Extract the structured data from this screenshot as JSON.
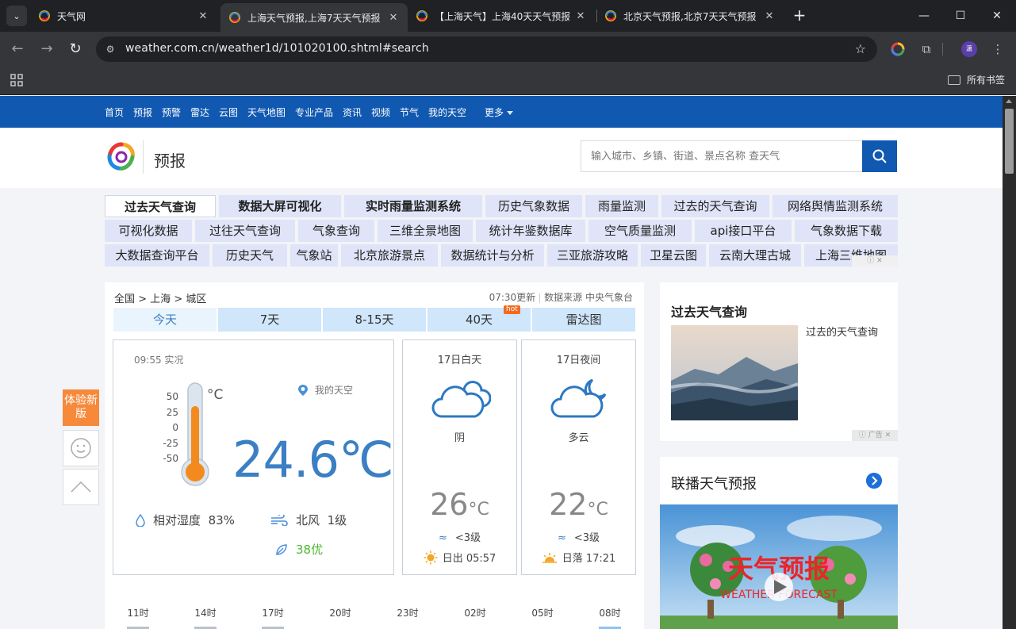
{
  "browser": {
    "tabs": [
      {
        "title": "天气网",
        "active": false
      },
      {
        "title": "上海天气预报,上海7天天气预报",
        "active": true
      },
      {
        "title": "【上海天气】上海40天天气预报",
        "active": false
      },
      {
        "title": "北京天气预报,北京7天天气预报",
        "active": false
      }
    ],
    "url": "weather.com.cn/weather1d/101020100.shtml#search",
    "bookmarks_label": "所有书签",
    "profile_initial": "潇"
  },
  "topnav": [
    "首页",
    "预报",
    "预警",
    "雷达",
    "云图",
    "天气地图",
    "专业产品",
    "资讯",
    "视频",
    "节气",
    "我的天空"
  ],
  "topnav_more": "更多",
  "header": {
    "title": "预报",
    "search_placeholder": "输入城市、乡镇、街道、景点名称 查天气"
  },
  "links": {
    "row1": [
      "过去天气查询",
      "数据大屏可视化",
      "实时雨量监测系统",
      "历史气象数据",
      "雨量监测",
      "过去的天气查询",
      "网络舆情监测系统"
    ],
    "row2": [
      "可视化数据",
      "过往天气查询",
      "气象查询",
      "三维全景地图",
      "统计年鉴数据库",
      "空气质量监测",
      "api接口平台",
      "气象数据下载"
    ],
    "row3": [
      "大数据查询平台",
      "历史天气",
      "气象站",
      "北京旅游景点",
      "数据统计与分析",
      "三亚旅游攻略",
      "卫星云图",
      "云南大理古城",
      "上海三维地图"
    ]
  },
  "breadcrumb": "全国 > 上海 > 城区",
  "update_time": "07:30更新",
  "data_source": "数据来源 中央气象台",
  "day_tabs": [
    "今天",
    "7天",
    "8-15天",
    "40天",
    "雷达图"
  ],
  "hot_label": "hot",
  "now": {
    "time_label": "09:55 实况",
    "my_sky": "我的天空",
    "thermo_ticks": [
      "50",
      "25",
      "0",
      "-25",
      "-50"
    ],
    "thermo_unit": "°C",
    "temperature": "24.6",
    "temp_unit": "℃",
    "humidity_label": "相对湿度",
    "humidity_value": "83%",
    "wind_dir": "北风",
    "wind_level": "1级",
    "aqi": "38优"
  },
  "day": {
    "title": "17日白天",
    "weather": "阴",
    "temp": "26",
    "unit": "°C",
    "wind": "<3级",
    "sun_label": "日出 05:57"
  },
  "night": {
    "title": "17日夜间",
    "weather": "多云",
    "temp": "22",
    "unit": "°C",
    "wind": "<3级",
    "sun_label": "日落 17:21"
  },
  "hours": [
    "11时",
    "14时",
    "17时",
    "20时",
    "23时",
    "02时",
    "05时",
    "08时"
  ],
  "side": {
    "past_title": "过去天气查询",
    "past_caption": "过去的天气查询",
    "ad_label": "广告",
    "broadcast_title": "联播天气预报",
    "video_title": "天气预报",
    "video_subtitle": "WEATHER FORECAST"
  },
  "float": {
    "tiyan": "体验新版"
  }
}
